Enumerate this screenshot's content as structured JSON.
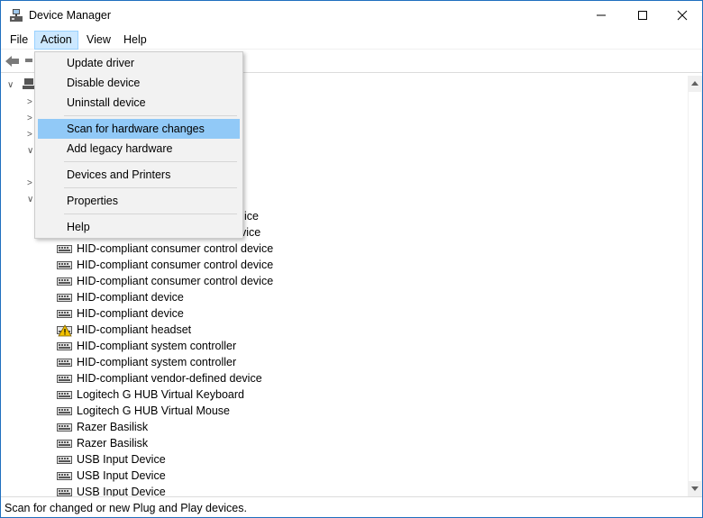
{
  "window": {
    "title": "Device Manager"
  },
  "menubar": {
    "items": [
      {
        "label": "File"
      },
      {
        "label": "Action",
        "active": true
      },
      {
        "label": "View"
      },
      {
        "label": "Help"
      }
    ]
  },
  "action_menu": {
    "items": [
      {
        "label": "Update driver"
      },
      {
        "label": "Disable device"
      },
      {
        "label": "Uninstall device"
      },
      {
        "label": "Scan for hardware changes",
        "highlighted": true
      },
      {
        "label": "Add legacy hardware"
      },
      {
        "label": "Devices and Printers"
      },
      {
        "label": "Properties"
      },
      {
        "label": "Help"
      }
    ]
  },
  "tree": {
    "partial_rows": [
      {
        "label": "ice"
      },
      {
        "label": "vice"
      }
    ],
    "devices": [
      {
        "label": "HID-compliant consumer control device",
        "icon": "hid-device-icon"
      },
      {
        "label": "HID-compliant consumer control device",
        "icon": "hid-device-icon"
      },
      {
        "label": "HID-compliant consumer control device",
        "icon": "hid-device-icon"
      },
      {
        "label": "HID-compliant device",
        "icon": "hid-device-icon"
      },
      {
        "label": "HID-compliant device",
        "icon": "hid-device-icon"
      },
      {
        "label": "HID-compliant headset",
        "icon": "warning-device-icon"
      },
      {
        "label": "HID-compliant system controller",
        "icon": "hid-device-icon"
      },
      {
        "label": "HID-compliant system controller",
        "icon": "hid-device-icon"
      },
      {
        "label": "HID-compliant vendor-defined device",
        "icon": "hid-device-icon"
      },
      {
        "label": "Logitech G HUB Virtual Keyboard",
        "icon": "hid-device-icon"
      },
      {
        "label": "Logitech G HUB Virtual Mouse",
        "icon": "hid-device-icon"
      },
      {
        "label": "Razer Basilisk",
        "icon": "hid-device-icon"
      },
      {
        "label": "Razer Basilisk",
        "icon": "hid-device-icon"
      },
      {
        "label": "USB Input Device",
        "icon": "hid-device-icon"
      },
      {
        "label": "USB Input Device",
        "icon": "hid-device-icon"
      },
      {
        "label": "USB Input Device",
        "icon": "hid-device-icon"
      }
    ]
  },
  "statusbar": {
    "text": "Scan for changed or new Plug and Play devices."
  },
  "colors": {
    "menu_highlight": "#91c9f7",
    "active_menu": "#cce8ff",
    "warning": "#f2c200"
  }
}
